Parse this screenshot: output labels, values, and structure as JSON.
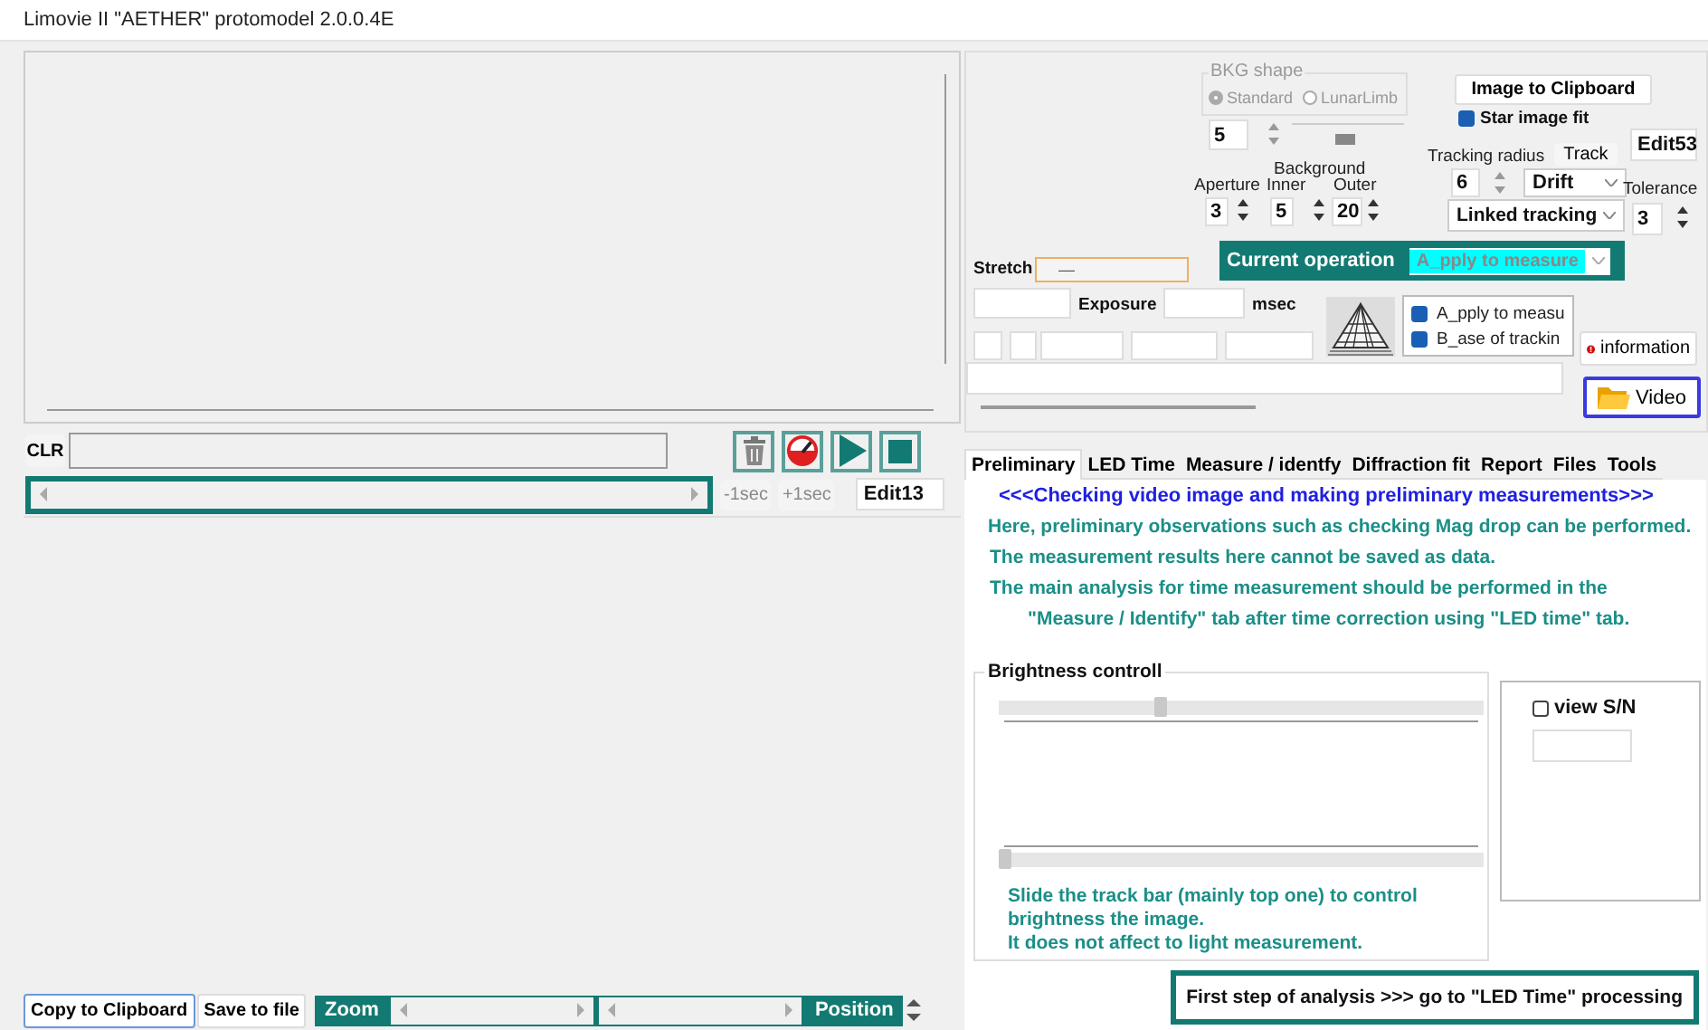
{
  "window": {
    "title": "Limovie II  \"AETHER\"  protomodel 2.0.0.4E"
  },
  "left": {
    "clr_button": "CLR",
    "time_buttons": [
      "-1sec",
      "+1sec"
    ],
    "edit_field": "Edit13",
    "bottom_buttons": [
      "Copy to Clipboard",
      "Save to file"
    ],
    "zoom_label": "Zoom",
    "position_label": "Position"
  },
  "controls": {
    "bkg_shape": {
      "title": "BKG shape",
      "disabled": true,
      "options": [
        {
          "label": "Standard",
          "selected": true
        },
        {
          "label": "LunarLimb",
          "selected": false
        }
      ]
    },
    "spin_value": "5",
    "background_label": "Background",
    "aperture": {
      "label": "Aperture",
      "value": "3"
    },
    "inner": {
      "label": "Inner",
      "value": "5"
    },
    "outer": {
      "label": "Outer",
      "value": "20"
    },
    "image_to_clipboard": "Image to Clipboard",
    "star_image_fit": {
      "label": "Star image fit",
      "checked": true
    },
    "edit53": "Edit53",
    "tracking_radius": {
      "label": "Tracking radius",
      "value": "6"
    },
    "track_button": "Track",
    "drift_select": "Drift",
    "linked_select": "Linked tracking",
    "tolerance": {
      "label": "Tolerance",
      "value": "3"
    },
    "current_operation": {
      "label": "Current operation",
      "value": "A_pply to measure"
    },
    "stretch": {
      "label": "Stretch",
      "value": "—"
    },
    "exposure": {
      "label": "Exposure",
      "unit": "msec"
    },
    "checks": [
      {
        "label": "A_pply to measu",
        "checked": true
      },
      {
        "label": "B_ase of trackin",
        "checked": true
      }
    ],
    "information_button": "information",
    "video_button": "Video"
  },
  "tabs": [
    {
      "label": "Preliminary",
      "selected": true
    },
    {
      "label": "LED Time",
      "selected": false
    },
    {
      "label": "Measure / identfy",
      "selected": false
    },
    {
      "label": "Diffraction fit",
      "selected": false
    },
    {
      "label": "Report",
      "selected": false
    },
    {
      "label": "Files",
      "selected": false
    },
    {
      "label": "Tools",
      "selected": false
    }
  ],
  "preliminary": {
    "heading": "<<<Checking video image and making preliminary measurements>>>",
    "lines": [
      "Here, preliminary observations such as checking Mag drop can be performed.",
      "The measurement results here cannot be saved as data.",
      "The main analysis for time measurement should be performed in the",
      "\"Measure / Identify\" tab after time correction using \"LED time\" tab."
    ]
  },
  "brightness": {
    "title": "Brightness controll",
    "sliders": [
      {
        "level": 0.32
      },
      {
        "level": 0.0
      }
    ],
    "note": [
      "Slide the track bar (mainly top one)  to control",
      "brightness the image.",
      "It does not affect to light measurement."
    ]
  },
  "view_sn": {
    "label": "view S/N",
    "checked": false
  },
  "next_step": "First step of analysis >>> go to  \"LED Time\" processing"
}
